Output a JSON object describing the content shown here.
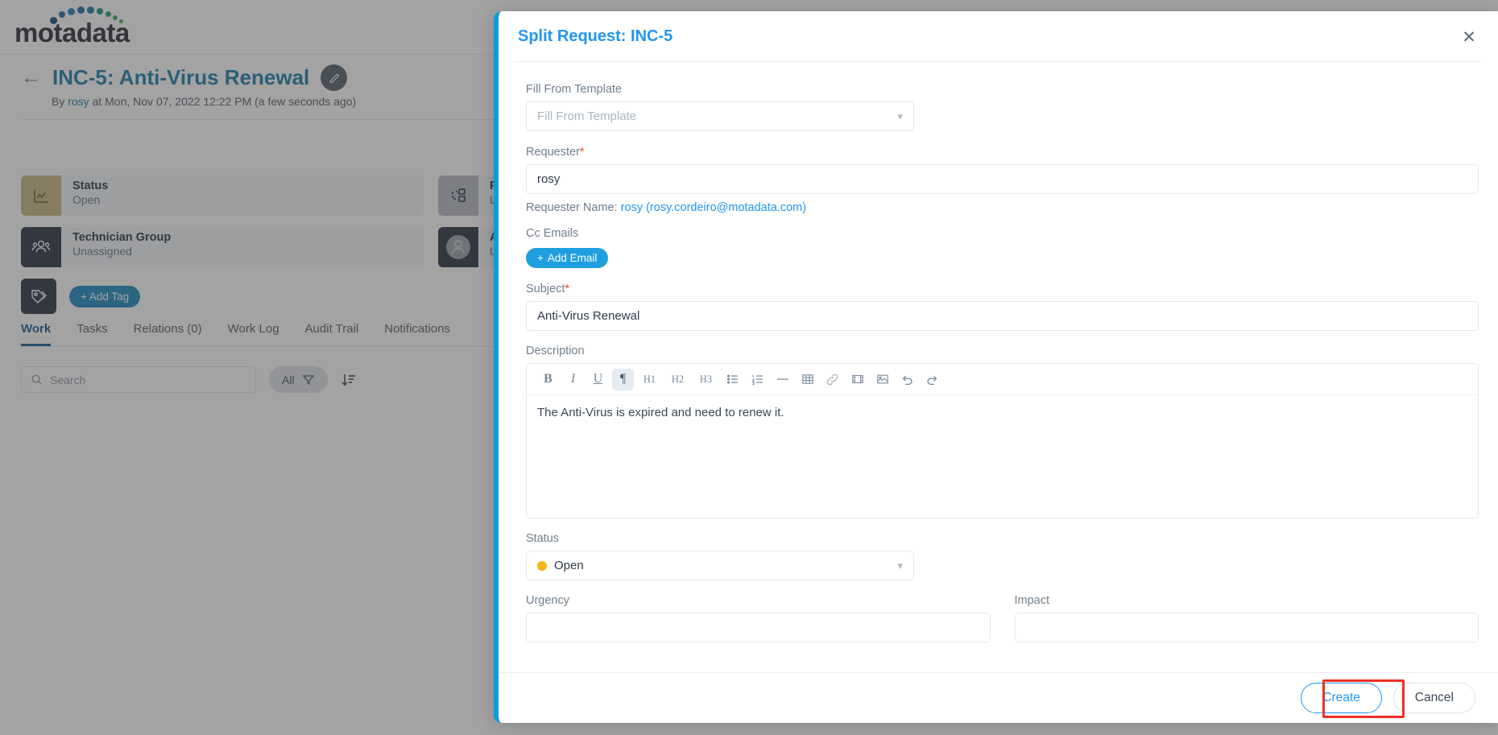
{
  "app": {
    "logo_text": "motadata",
    "brand_blue": "#1e7fa8",
    "accent_blue": "#2196f3",
    "modal_border_blue": "#0d9bde"
  },
  "ticket": {
    "back_icon": "back-arrow-icon",
    "title": "INC-5: Anti-Virus Renewal",
    "edit_icon": "pencil-icon",
    "byline_prefix": "By ",
    "byline_user": "rosy",
    "byline_rest": " at Mon, Nov 07, 2022 12:22 PM (a few seconds ago)",
    "cards": [
      {
        "label": "Status",
        "value": "Open",
        "icon": "chart-line-icon",
        "icon_bg": "#c9b683"
      },
      {
        "label": "Priority",
        "value": "Low",
        "icon": "priority-flow-icon",
        "icon_bg": "#b7bcc4"
      },
      {
        "label": "Technician Group",
        "value": "Unassigned",
        "icon": "users-group-icon",
        "icon_bg": "#2c3644"
      },
      {
        "label": "Assignee",
        "value": "Unassigned",
        "icon": "avatar-icon",
        "icon_bg": "#2c3644"
      }
    ],
    "tag_icon": "tags-icon",
    "add_tag_label": "+ Add Tag",
    "tabs": [
      {
        "label": "Work",
        "active": true
      },
      {
        "label": "Tasks",
        "active": false
      },
      {
        "label": "Relations (0)",
        "active": false
      },
      {
        "label": "Work Log",
        "active": false
      },
      {
        "label": "Audit Trail",
        "active": false
      },
      {
        "label": "Notifications",
        "active": false
      }
    ],
    "search_placeholder": "Search",
    "filter_label": "All",
    "sort_icon": "sort-descending-icon"
  },
  "modal": {
    "title": "Split Request: INC-5",
    "close_icon": "close-icon",
    "fields": {
      "template_label": "Fill From Template",
      "template_placeholder": "Fill From Template",
      "requester_label": "Requester",
      "requester_value": "rosy",
      "requester_name_label": "Requester Name:",
      "requester_name_value": "rosy (rosy.cordeiro@motadata.com)",
      "cc_label": "Cc Emails",
      "add_email_label": "Add Email",
      "subject_label": "Subject",
      "subject_value": "Anti-Virus Renewal",
      "description_label": "Description",
      "description_value": "The Anti-Virus is expired and need to renew it.",
      "status_label": "Status",
      "status_value": "Open",
      "status_color": "#f5b614",
      "urgency_label": "Urgency",
      "urgency_value": "",
      "impact_label": "Impact",
      "impact_value": ""
    },
    "toolbar": [
      {
        "name": "bold-icon",
        "glyph": "B",
        "style": "bold",
        "active": false
      },
      {
        "name": "italic-icon",
        "glyph": "I",
        "style": "ital",
        "active": false
      },
      {
        "name": "underline-icon",
        "glyph": "U",
        "style": "und",
        "active": false
      },
      {
        "name": "paragraph-icon",
        "glyph": "¶",
        "style": "pil",
        "active": true
      },
      {
        "name": "heading-1-icon",
        "glyph": "H1",
        "style": "hx",
        "active": false
      },
      {
        "name": "heading-2-icon",
        "glyph": "H2",
        "style": "hx",
        "active": false
      },
      {
        "name": "heading-3-icon",
        "glyph": "H3",
        "style": "hx",
        "active": false
      }
    ],
    "footer": {
      "create_label": "Create",
      "cancel_label": "Cancel",
      "highlight_color": "#f22f26"
    }
  },
  "topbar": {
    "button_label": "",
    "icons": [
      "bell-icon",
      "help-icon",
      "apps-icon",
      "user-avatar-icon"
    ]
  }
}
